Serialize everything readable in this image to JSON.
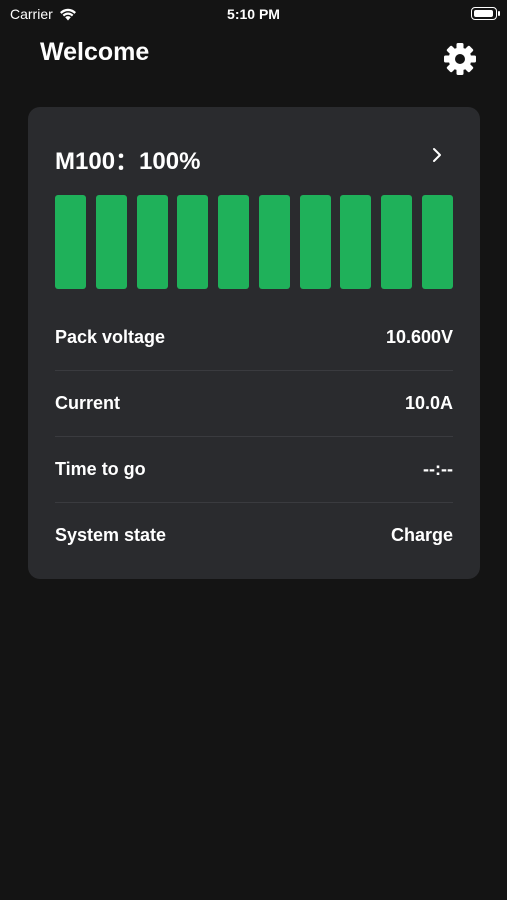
{
  "status_bar": {
    "carrier": "Carrier",
    "time": "5:10 PM",
    "battery_level": 1.0
  },
  "header": {
    "title": "Welcome",
    "settings_icon": "gear-icon"
  },
  "battery_card": {
    "title": "M100：100%",
    "chevron_icon": "chevron-right-icon",
    "cell_color": "#1fb15a",
    "cells": [
      1,
      1,
      1,
      1,
      1,
      1,
      1,
      1,
      1,
      1
    ],
    "rows": [
      {
        "label": "Pack voltage",
        "value": "10.600V"
      },
      {
        "label": "Current",
        "value": "10.0A"
      },
      {
        "label": "Time to go",
        "value": "--:--"
      },
      {
        "label": "System state",
        "value": "Charge"
      }
    ]
  }
}
